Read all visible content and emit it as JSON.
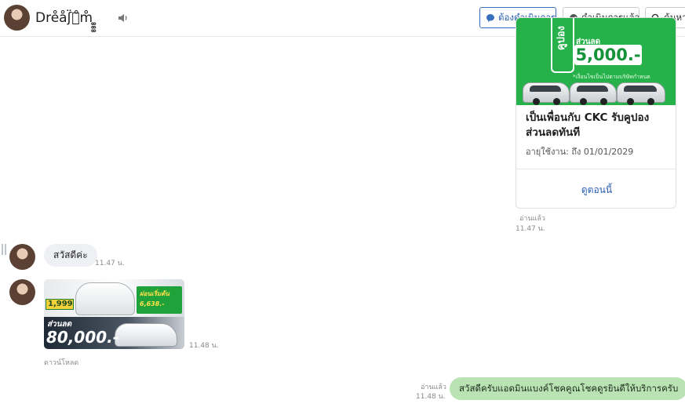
{
  "header": {
    "contact_name": "Dre̊åʃ̈ᄋ̊m̊ ͚͚͚",
    "speaker_icon": "speaker-icon",
    "buttons": {
      "todo": "ต้องดำเนินการ",
      "done": "ดำเนินการแล้ว",
      "search": "ค้นหา"
    }
  },
  "colors": {
    "accent": "#2a5db0",
    "card_green": "#26b14a",
    "bubble_out": "#b9e3b2",
    "bubble_in": "#eef0f3"
  },
  "coupon_card": {
    "image": {
      "side_text": "คูปอง",
      "discount_label": "ส่วนลด",
      "discount_value": "5,000.-",
      "note": "*เงื่อนไขเป็นไปตามบริษัทกำหนด"
    },
    "title": "เป็นเพื่อนกับ CKC รับคูปองส่วนลดทันที",
    "validity": "อายุใช้งาน: ถึง 01/01/2029",
    "link_label": "ดูตอนนี้",
    "read_label": "อ่านแล้ว",
    "time": "11.47 น."
  },
  "messages": {
    "greeting": {
      "text": "สวัสดีค่ะ",
      "time": "11.47 น."
    },
    "promo_image": {
      "price_tag": "1,999",
      "installment": "ผ่อนเริ่มต้น 6,638.-",
      "save_label": "ส่วนลด",
      "save_value": "80,000.-",
      "time": "11.48 น.",
      "download_label": "ดาวน์โหลด"
    },
    "reply": {
      "text": "สวัสดีครับแอดมินแบงค์โชคคูณโชคดูรยินดีให้บริการครับ",
      "read_label": "อ่านแล้ว",
      "time": "11.48 น."
    }
  }
}
